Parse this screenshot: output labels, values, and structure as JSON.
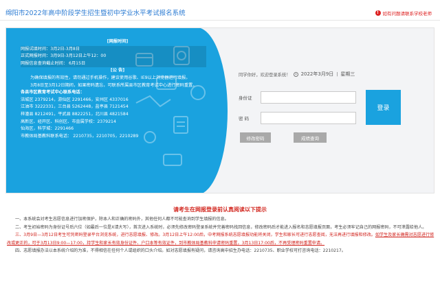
{
  "header": {
    "title": "绵阳市2022年高中阶段学生招生暨初中学业水平考试报名系统",
    "help_link": "如有问题请联系学校老师"
  },
  "notice": {
    "time_title": "[网报时间]",
    "lines": [
      "网报试填时间：3月2日-3月8日",
      "正式网报时间：3月9日-3月12日上午12：00",
      "网报信息查询截止时间：  6月15日"
    ],
    "announce_title": "[公    告]",
    "para1": "为确保填报的有效性，请勿通过手机操作，建议使用谷歌、IE9以上浏览器进行填报。",
    "para2": "3月8日至3月12日期间，如果密码遗忘，可联系所属县市区教育考试中心进行密码重置。",
    "contacts_title": "各县市区教育考试中心联系电话：",
    "contacts": [
      "涪城区  2379214，游仙区  2291466，安州区  4337016",
      "江油市  3222331，三台县  5262448，盐亭县  7121454",
      "梓潼县  8212491，平武县  8822251，北川县  4821584",
      "高新区、经开区、科创区、市直属学校：2379214",
      "仙海区，科学城：2291466",
      "市教体局基教科联系电话：  2210735，2210705，2210289"
    ]
  },
  "login": {
    "greeting": "同学你好，欢迎登录系统！",
    "date": "2022年3月9日",
    "weekday": "星期三",
    "id_label": "身份证",
    "pw_label": "密   码",
    "id_value": "",
    "pw_value": "",
    "login_button": "登录",
    "change_password": "修改密码",
    "score_query": "成绩查询"
  },
  "instructions": {
    "title": "请考生在网报登录前认真阅读以下提示",
    "item1": "一、本系统会对考生志愿信息进行加密保护，除本人和正确的密码外，其他任何人都不可能查询到学生填报的信息。",
    "item2a": "二、考生初始密码为身份证号后六位（如最后一位是X请大写），首次进入系统时，必须先修改密码登录系统并完善密码找回信息，修改密码后才能进入报名和志愿填报页面，考生必须牢记自己的网报密码，不可泄露给他人。",
    "item3_red1": "三、3月9日—3月12日考生可凭密码登录平台浏览系统，进行志愿填报、修改。3月12日上午12:00后，中考网报系统志愿填报功能将关闭，学生和家长可进行志愿查阅，无法再进行填报和修改。",
    "item3_red2": "如学生及家长确需对志愿进行修改或更正的，可于3月13日9:00—17:00，持学生和家长有效身份证件、户口本等有效证件，到市教体局基教科申请密码重置，3月13日17:00后，不再受理密码重置申请。",
    "item4": "四、志愿填报办法以本系统介绍的为准，不得相信在任何个人或组织的口头介绍。如对志愿填报有疑问，请咨询高中招生办电话：2210735、职业学校可打咨询电话：2210217。"
  },
  "colors": {
    "primary_blue": "#1aa2df",
    "title_blue": "#2b7bd3",
    "alert_red": "#d2261e",
    "gray_button": "#a9a9a9"
  }
}
